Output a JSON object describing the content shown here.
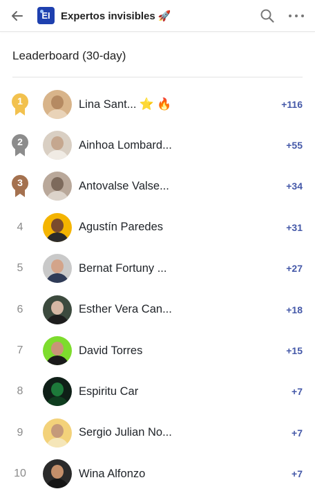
{
  "header": {
    "back_icon": "arrow-left-icon",
    "logo_text": "EI",
    "title": "Expertos invisibles 🚀",
    "search_icon": "search-icon",
    "more_icon": "more-horizontal-icon"
  },
  "section_title": "Leaderboard (30-day)",
  "colors": {
    "score": "#4458a8",
    "gold": "#f2c14e",
    "silver": "#8c8c8c",
    "bronze": "#a4714f"
  },
  "leaderboard": [
    {
      "rank": "1",
      "name": "Lina Sant...",
      "emoji": "⭐ 🔥",
      "score": "+116"
    },
    {
      "rank": "2",
      "name": "Ainhoa Lombard...",
      "emoji": "",
      "score": "+55"
    },
    {
      "rank": "3",
      "name": "Antovalse Valse...",
      "emoji": "",
      "score": "+34"
    },
    {
      "rank": "4",
      "name": "Agustín Paredes",
      "emoji": "",
      "score": "+31"
    },
    {
      "rank": "5",
      "name": "Bernat Fortuny ...",
      "emoji": "",
      "score": "+27"
    },
    {
      "rank": "6",
      "name": "Esther Vera Can...",
      "emoji": "",
      "score": "+18"
    },
    {
      "rank": "7",
      "name": "David Torres",
      "emoji": "",
      "score": "+15"
    },
    {
      "rank": "8",
      "name": "Espiritu Car",
      "emoji": "",
      "score": "+7"
    },
    {
      "rank": "9",
      "name": "Sergio Julian No...",
      "emoji": "",
      "score": "+7"
    },
    {
      "rank": "10",
      "name": "Wina Alfonzo",
      "emoji": "",
      "score": "+7"
    }
  ]
}
